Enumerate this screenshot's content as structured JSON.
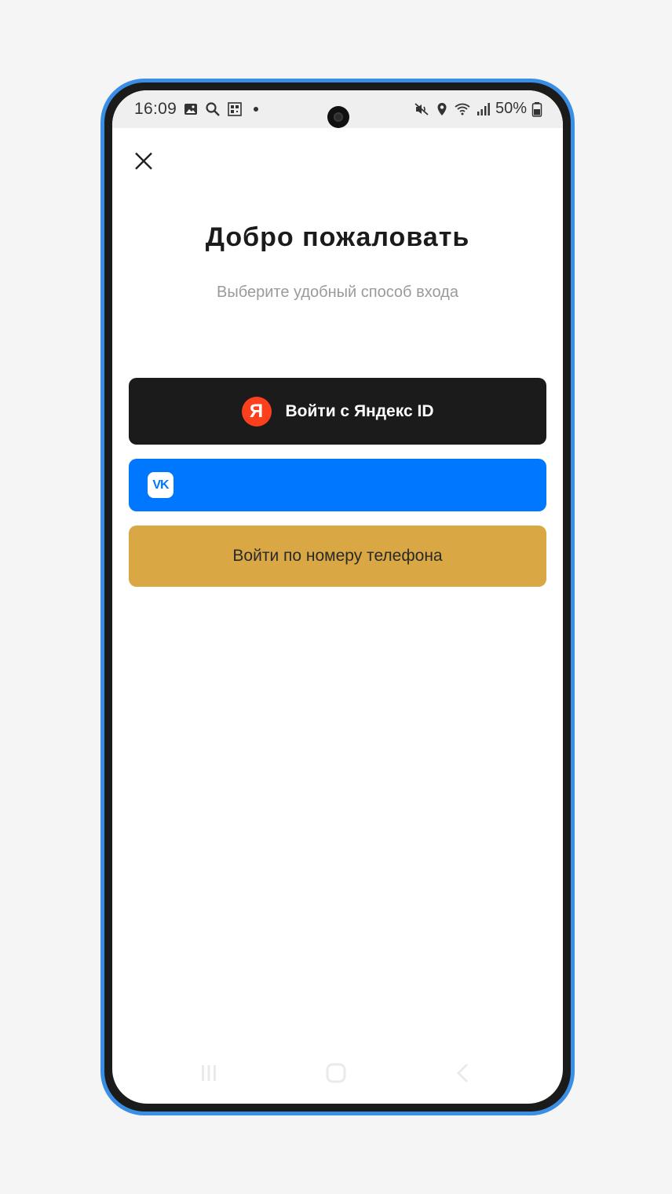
{
  "status_bar": {
    "time": "16:09",
    "battery": "50%",
    "left_icons": [
      "gallery-icon",
      "search-icon",
      "qr-icon"
    ],
    "right_icons": [
      "mute-icon",
      "location-icon",
      "wifi-icon",
      "signal-icon",
      "battery-icon"
    ]
  },
  "header": {
    "close_icon": "close-icon"
  },
  "welcome": {
    "title": "Добро пожаловать",
    "subtitle": "Выберите удобный способ входа"
  },
  "login": {
    "yandex_logo": "Я",
    "yandex_label": "Войти с Яндекс ID",
    "vk_logo": "VK",
    "phone_label": "Войти по номеру телефона"
  },
  "colors": {
    "frame": "#3a8ee6",
    "yandex_button": "#1b1b1b",
    "yandex_logo": "#fc3f1d",
    "vk_button": "#0077ff",
    "phone_button": "#d9a743"
  }
}
